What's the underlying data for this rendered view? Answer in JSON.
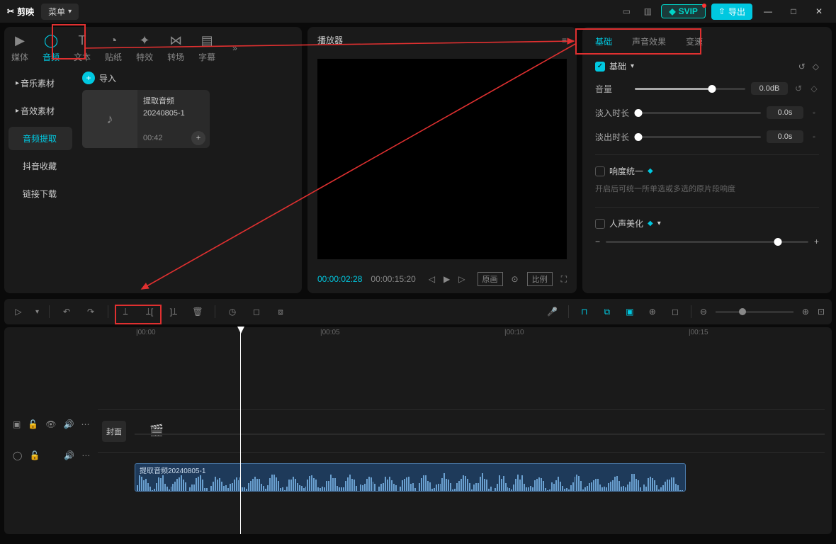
{
  "titlebar": {
    "logo": "剪映",
    "menu": "菜单",
    "svip": "SVIP",
    "export": "导出"
  },
  "media_tabs": {
    "media": "媒体",
    "audio": "音频",
    "text": "文本",
    "sticker": "贴纸",
    "effect": "特效",
    "transition": "转场",
    "subtitle": "字幕"
  },
  "media_side": {
    "music": "音乐素材",
    "sfx": "音效素材",
    "extract": "音频提取",
    "douyin": "抖音收藏",
    "link": "链接下载"
  },
  "media_content": {
    "import": "导入",
    "card_title": "提取音频",
    "card_name": "20240805-1",
    "card_duration": "00:42"
  },
  "player": {
    "title": "播放器",
    "tc_current": "00:00:02:28",
    "tc_total": "00:00:15:20",
    "orig": "原画",
    "ratio": "比例"
  },
  "props": {
    "tab_basic": "基础",
    "tab_sound": "声音效果",
    "tab_speed": "变速",
    "section_basic": "基础",
    "volume_label": "音量",
    "volume_value": "0.0dB",
    "fadein_label": "淡入时长",
    "fadein_value": "0.0s",
    "fadeout_label": "淡出时长",
    "fadeout_value": "0.0s",
    "loudness_label": "响度统一",
    "loudness_desc": "开启后可统一所单选或多选的原片段响度",
    "voice_label": "人声美化"
  },
  "timeline": {
    "t0": "|00:00",
    "t5": "|00:05",
    "t10": "|00:10",
    "t15": "|00:15",
    "cover": "封面",
    "clip_title": "提取音频20240805-1"
  }
}
